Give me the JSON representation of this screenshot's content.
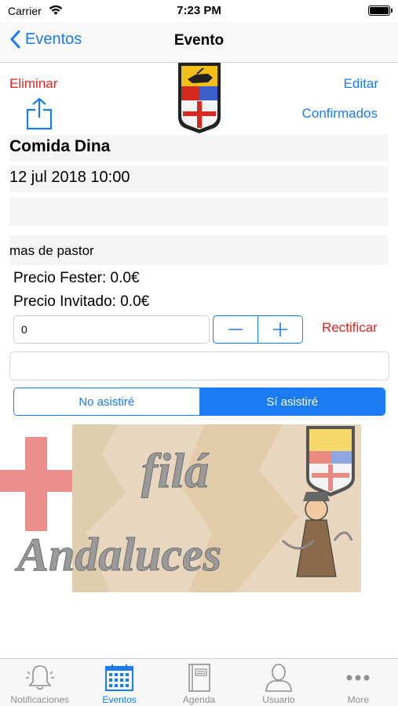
{
  "status_bar": {
    "carrier": "Carrier",
    "time": "7:23 PM"
  },
  "nav": {
    "back_label": "Eventos",
    "title": "Evento"
  },
  "actions": {
    "delete_label": "Eliminar",
    "edit_label": "Editar",
    "confirmed_label": "Confirmados"
  },
  "event": {
    "title": "Comida Dina",
    "date": "12 jul 2018 10:00",
    "location": "",
    "description": "mas de pastor",
    "price_fester": "Precio Fester: 0.0€",
    "price_guest": "Precio Invitado: 0.0€"
  },
  "guests": {
    "quantity_value": "0",
    "rectify_label": "Rectificar",
    "comment_value": ""
  },
  "attendance": {
    "options": [
      "No asistiré",
      "Sí asistiré"
    ],
    "selected": "Sí asistiré"
  },
  "banner": {
    "line1": "filá",
    "line2": "Andaluces"
  },
  "tab_bar": {
    "items": [
      {
        "label": "Notificaciones",
        "icon": "bell-icon"
      },
      {
        "label": "Eventos",
        "icon": "calendar-icon"
      },
      {
        "label": "Agenda",
        "icon": "notebook-icon"
      },
      {
        "label": "Usuario",
        "icon": "user-icon"
      },
      {
        "label": "More",
        "icon": "more-icon"
      }
    ],
    "active": "Eventos"
  },
  "colors": {
    "accent": "#1a7bf2",
    "destructive": "#e8231c",
    "inactive": "#8e8e93"
  }
}
